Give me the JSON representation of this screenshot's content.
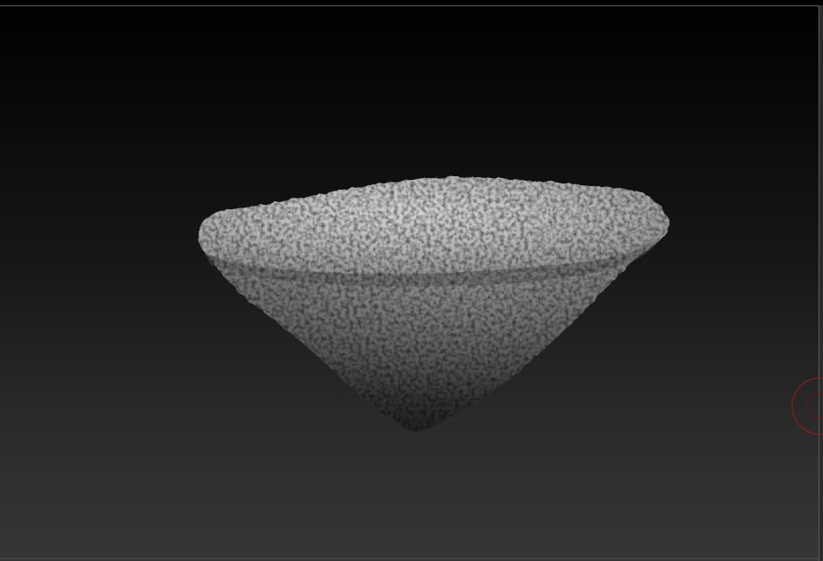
{
  "viewport": {
    "background_top_color": "#000000",
    "background_bottom_color": "#363636",
    "frame_color": "#5a5a5a"
  },
  "model": {
    "material_color": "#8a8a8a",
    "highlight_color": "#d0d0d0",
    "shadow_color": "#1c1c1c"
  },
  "gizmo": {
    "icon": "rotation-gizmo-icon",
    "color": "#9b1b1b"
  }
}
